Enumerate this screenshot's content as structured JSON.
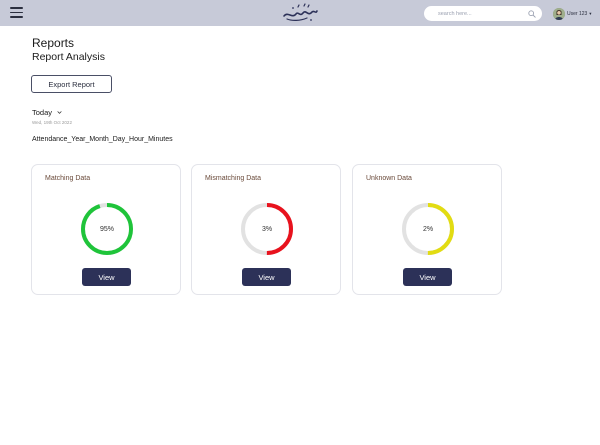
{
  "header": {
    "search": {
      "placeholder": "search here...",
      "value": ""
    },
    "user": {
      "name": "User 123"
    }
  },
  "page": {
    "title": "Reports",
    "subtitle": "Report Analysis",
    "export_label": "Export Report",
    "date": {
      "selected": "Today",
      "sub": "Wed, 19th Oct 2022"
    },
    "file_name": "Attendance_Year_Month_Day_Hour_Minutes"
  },
  "cards": [
    {
      "title": "Matching Data",
      "value_label": "95%",
      "percent": 95,
      "color": "#1fc43a",
      "button": "View"
    },
    {
      "title": "Mismatching Data",
      "value_label": "3%",
      "percent": 3,
      "color": "#e8121d",
      "button": "View"
    },
    {
      "title": "Unknown Data",
      "value_label": "2%",
      "percent": 2,
      "color": "#e2dc12",
      "button": "View"
    }
  ],
  "colors": {
    "topbar": "#c7cad8",
    "button_primary": "#2c3158",
    "gauge_track": "#e2e2e2"
  },
  "icons": [
    "menu-icon",
    "search-icon",
    "chevron-down-icon"
  ]
}
